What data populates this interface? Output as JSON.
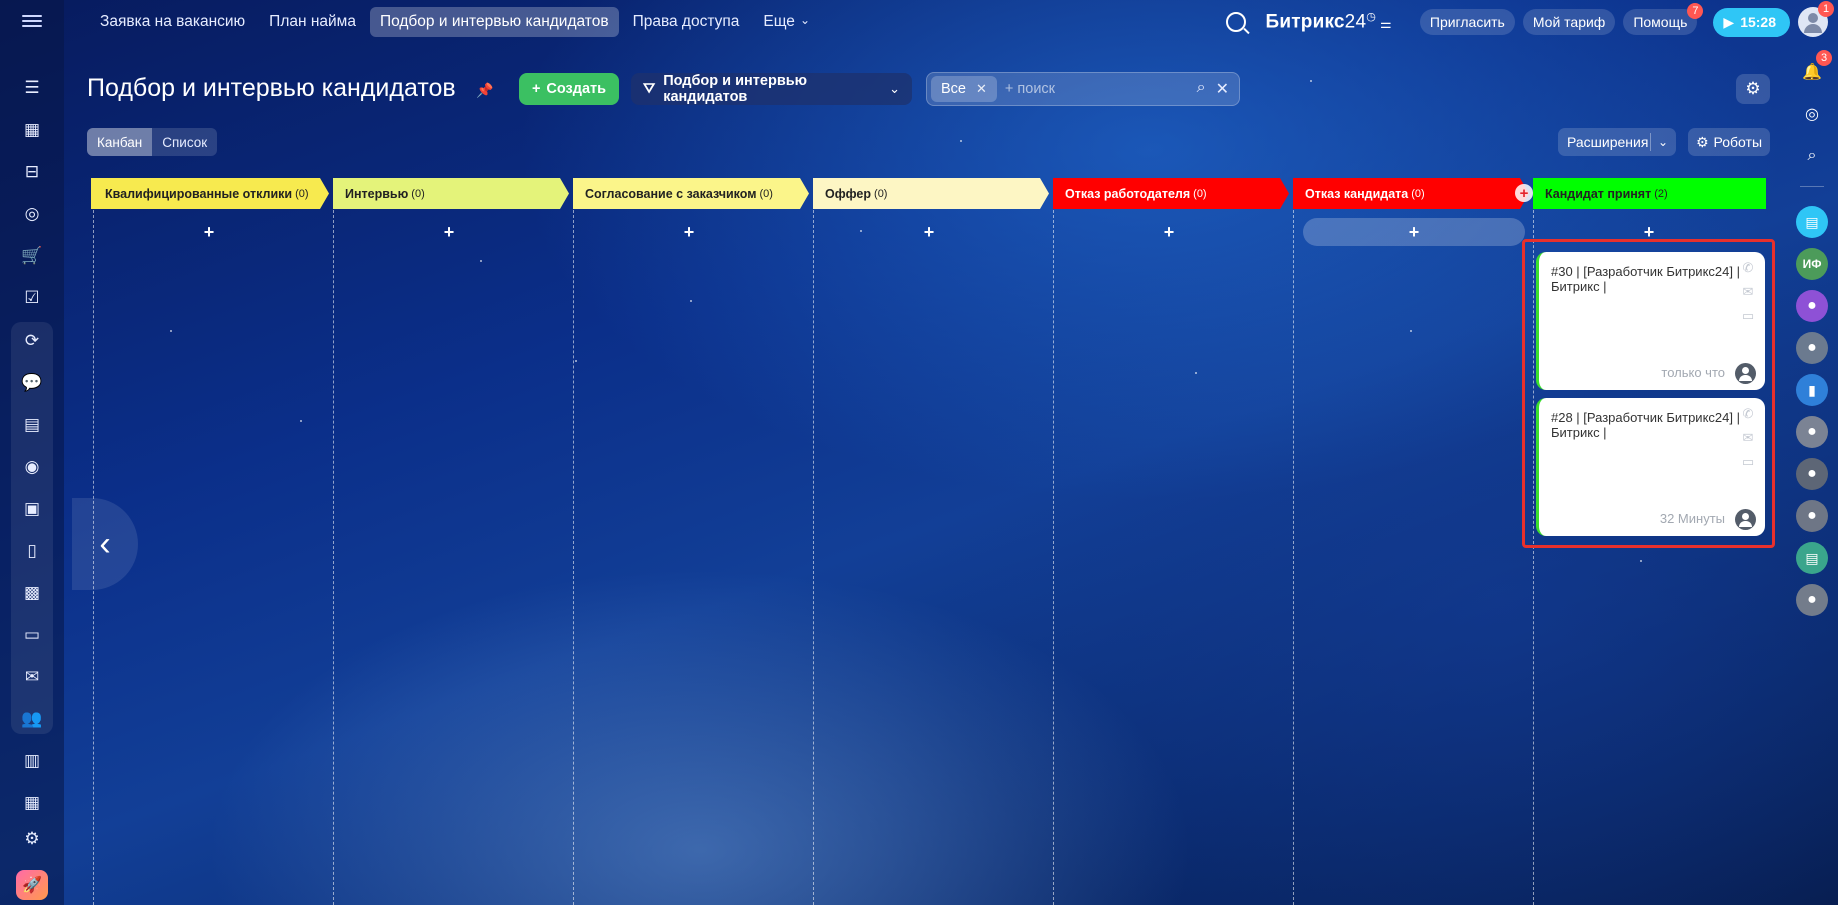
{
  "topnav": {
    "items": [
      {
        "label": "Заявка на вакансию",
        "active": false
      },
      {
        "label": "План найма",
        "active": false
      },
      {
        "label": "Подбор и интервью кандидатов",
        "active": true
      },
      {
        "label": "Права доступа",
        "active": false
      }
    ],
    "more_label": "Еще",
    "brand_name": "Битрикс",
    "brand_num": "24",
    "invite_label": "Пригласить",
    "tariff_label": "Мой тариф",
    "help_label": "Помощь",
    "help_badge": "7",
    "time": "15:28",
    "avatar_badge": "1"
  },
  "toolbar": {
    "title": "Подбор и интервью кандидатов",
    "create_label": "Создать",
    "pipeline_label": "Подбор и интервью кандидатов",
    "filter_tag": "Все",
    "search_placeholder": "+ поиск",
    "view_kanban": "Канбан",
    "view_list": "Список",
    "extensions_label": "Расширения",
    "robots_label": "Роботы"
  },
  "right_rail": {
    "notifications_badge": "3",
    "avatar_initials": "ИФ"
  },
  "columns": [
    {
      "title": "Квалифицированные отклики",
      "count": "(0)",
      "color": "#f7ea4f",
      "text_color": "dark"
    },
    {
      "title": "Интервью",
      "count": "(0)",
      "color": "#e4f37a",
      "text_color": "dark"
    },
    {
      "title": "Согласование с заказчиком",
      "count": "(0)",
      "color": "#fbf58a",
      "text_color": "dark"
    },
    {
      "title": "Оффер",
      "count": "(0)",
      "color": "#fdf6c4",
      "text_color": "dark"
    },
    {
      "title": "Отказ работодателя",
      "count": "(0)",
      "color": "#ff0000",
      "text_color": "light"
    },
    {
      "title": "Отказ кандидата",
      "count": "(0)",
      "color": "#ff0000",
      "text_color": "light"
    },
    {
      "title": "Кандидат принят",
      "count": "(2)",
      "color": "#00ff00",
      "text_color": "dark"
    }
  ],
  "add_symbol": "+",
  "cards": [
    {
      "title": "#30 | [Разработчик Битрикс24] | Битрикс |",
      "time": "только что"
    },
    {
      "title": "#28 | [Разработчик Битрикс24] | Битрикс |",
      "time": "32 Минуты"
    }
  ]
}
